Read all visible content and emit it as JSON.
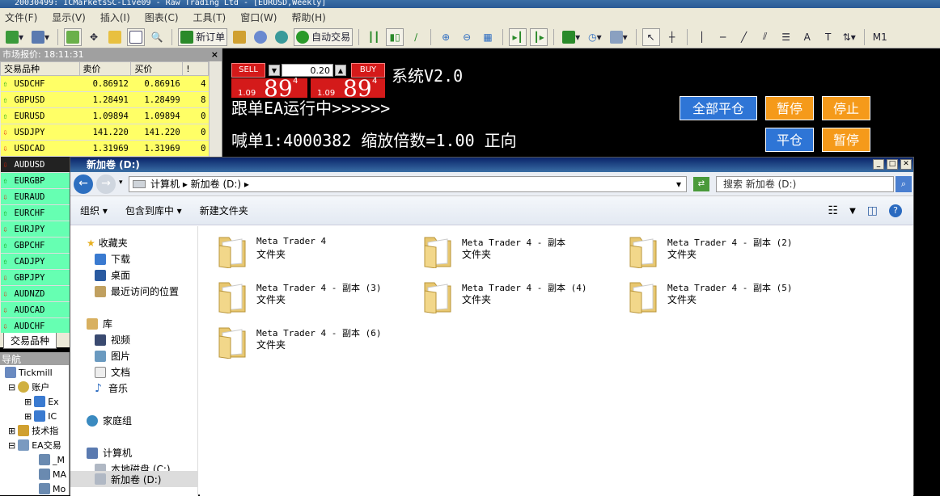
{
  "window": {
    "title": "20030499: ICMarketsSC-Live09 - Raw Trading Ltd - [EURUSD,Weekly]"
  },
  "menu": [
    "文件(F)",
    "显示(V)",
    "插入(I)",
    "图表(C)",
    "工具(T)",
    "窗口(W)",
    "帮助(H)"
  ],
  "toolbar": {
    "new_order": "新订单",
    "auto_trading": "自动交易",
    "timeframe": "M1"
  },
  "market_watch": {
    "header": "市场报价: 18:11:31",
    "close": "×",
    "columns": [
      "交易品种",
      "卖价",
      "买价",
      "!"
    ],
    "rows": [
      {
        "symbol": "USDCHF",
        "bid": "0.86912",
        "ask": "0.86916",
        "spread": "4",
        "dir": "up",
        "color": "yellow"
      },
      {
        "symbol": "GBPUSD",
        "bid": "1.28491",
        "ask": "1.28499",
        "spread": "8",
        "dir": "up",
        "color": "yellow"
      },
      {
        "symbol": "EURUSD",
        "bid": "1.09894",
        "ask": "1.09894",
        "spread": "0",
        "dir": "up",
        "color": "yellow"
      },
      {
        "symbol": "USDJPY",
        "bid": "141.220",
        "ask": "141.220",
        "spread": "0",
        "dir": "down",
        "color": "yellow"
      },
      {
        "symbol": "USDCAD",
        "bid": "1.31969",
        "ask": "1.31969",
        "spread": "0",
        "dir": "down",
        "color": "yellow"
      },
      {
        "symbol": "AUDUSD",
        "bid": "",
        "ask": "",
        "spread": "",
        "dir": "down",
        "color": "selected"
      },
      {
        "symbol": "EURGBP",
        "bid": "",
        "ask": "",
        "spread": "",
        "dir": "up",
        "color": "green"
      },
      {
        "symbol": "EURAUD",
        "bid": "",
        "ask": "",
        "spread": "",
        "dir": "down",
        "color": "green"
      },
      {
        "symbol": "EURCHF",
        "bid": "",
        "ask": "",
        "spread": "",
        "dir": "up",
        "color": "green"
      },
      {
        "symbol": "EURJPY",
        "bid": "",
        "ask": "",
        "spread": "",
        "dir": "down",
        "color": "green"
      },
      {
        "symbol": "GBPCHF",
        "bid": "",
        "ask": "",
        "spread": "",
        "dir": "up",
        "color": "green"
      },
      {
        "symbol": "CADJPY",
        "bid": "",
        "ask": "",
        "spread": "",
        "dir": "up",
        "color": "green"
      },
      {
        "symbol": "GBPJPY",
        "bid": "",
        "ask": "",
        "spread": "",
        "dir": "down",
        "color": "green"
      },
      {
        "symbol": "AUDNZD",
        "bid": "",
        "ask": "",
        "spread": "",
        "dir": "down",
        "color": "green"
      },
      {
        "symbol": "AUDCAD",
        "bid": "",
        "ask": "",
        "spread": "",
        "dir": "down",
        "color": "green"
      },
      {
        "symbol": "AUDCHF",
        "bid": "",
        "ask": "",
        "spread": "",
        "dir": "down",
        "color": "green"
      }
    ],
    "tab": "交易品种"
  },
  "navigator": {
    "header": "导航",
    "items": [
      "Tickmill",
      "账户",
      "Ex",
      "IC",
      "技术指",
      "EA交易",
      "_M",
      "MA",
      "Mo"
    ]
  },
  "trade_panel": {
    "sell": "SELL",
    "buy": "BUY",
    "lot": "0.20",
    "sell_price_small": "1.09",
    "sell_price_big": "89",
    "sell_price_sup": "4",
    "buy_price_small": "1.09",
    "buy_price_big": "89",
    "buy_price_sup": "4"
  },
  "ea": {
    "title": "系统V2.0",
    "status": "跟单EA运行中>>>>>>",
    "order_info": "喊单1:4000382 缩放倍数=1.00 正向",
    "close_all": "全部平仓",
    "pause": "暂停",
    "stop": "停止",
    "close": "平仓",
    "pause2": "暂停"
  },
  "explorer": {
    "title": "新加卷 (D:)",
    "breadcrumb": "计算机 ▸ 新加卷 (D:) ▸",
    "search_placeholder": "搜索 新加卷 (D:)",
    "commands": [
      "组织 ▾",
      "包含到库中 ▾",
      "新建文件夹"
    ],
    "tree": {
      "favorites": "收藏夹",
      "downloads": "下载",
      "desktop": "桌面",
      "recent": "最近访问的位置",
      "libraries": "库",
      "videos": "视频",
      "pictures": "图片",
      "documents": "文档",
      "music": "音乐",
      "homegroup": "家庭组",
      "computer": "计算机",
      "local_disk": "本地磁盘 (C:)",
      "new_volume": "新加卷 (D:)"
    },
    "files": [
      {
        "name": "Meta Trader 4",
        "type": "文件夹"
      },
      {
        "name": "Meta Trader 4 - 副本",
        "type": "文件夹"
      },
      {
        "name": "Meta Trader 4 - 副本 (2)",
        "type": "文件夹"
      },
      {
        "name": "Meta Trader 4 - 副本 (3)",
        "type": "文件夹"
      },
      {
        "name": "Meta Trader 4 - 副本 (4)",
        "type": "文件夹"
      },
      {
        "name": "Meta Trader 4 - 副本 (5)",
        "type": "文件夹"
      },
      {
        "name": "Meta Trader 4 - 副本 (6)",
        "type": "文件夹"
      }
    ]
  },
  "colors": {
    "sell_red": "#d41a1a",
    "ea_blue": "#2e75d6",
    "ea_orange": "#f59a1a",
    "mw_yellow": "#ffff66",
    "mw_green": "#66ffb2"
  }
}
